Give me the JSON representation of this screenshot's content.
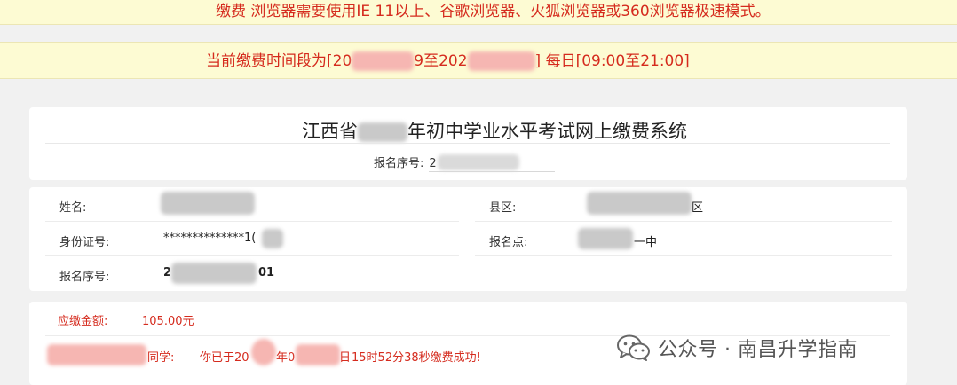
{
  "banners": {
    "browser_notice": "缴费 浏览器需要使用IE 11以上、谷歌浏览器、火狐浏览器或360浏览器极速模式。",
    "period_prefix": "当前缴费时间段为[20",
    "period_mid1": "9至202",
    "period_suffix": "] 每日[09:00至21:00]"
  },
  "system": {
    "title_part1": "江西省",
    "title_part2": "年初中学业水平考试网上缴费系统",
    "reg_label": "报名序号:",
    "reg_value_visible": "2"
  },
  "student": {
    "name_label": "姓名:",
    "county_label": "县区:",
    "county_value_visible": "区",
    "id_label": "身份证号:",
    "id_value_visible": "**************1(",
    "site_label": "报名点:",
    "site_value_visible": "一中",
    "reg_label": "报名序号:",
    "reg_value_start": "2",
    "reg_value_end": "01"
  },
  "payment": {
    "amount_label": "应缴金额:",
    "amount_value": "105.00元",
    "student_suffix": "同学:",
    "paid_prefix": "你已于20",
    "paid_mid1": "年0",
    "paid_mid2": "日",
    "paid_suffix": "15时52分38秒缴费成功!"
  },
  "watermark": {
    "text": "公众号 · 南昌升学指南",
    "icon": "wechat-icon"
  }
}
